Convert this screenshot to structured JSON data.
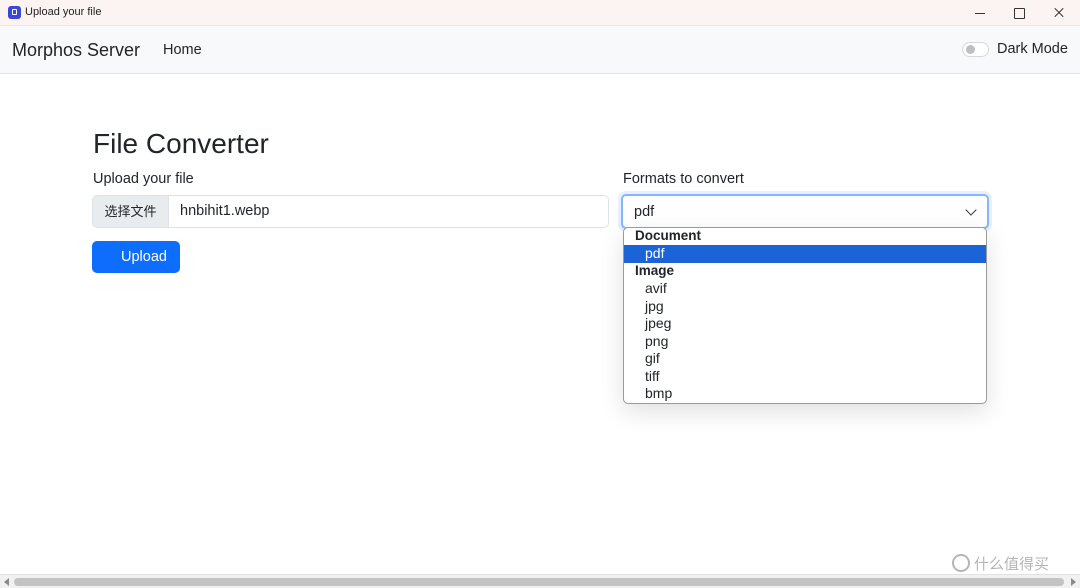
{
  "window": {
    "title": "Upload your file"
  },
  "navbar": {
    "brand": "Morphos Server",
    "home_link": "Home",
    "dark_mode_label": "Dark Mode",
    "dark_mode_on": false
  },
  "main": {
    "title": "File Converter",
    "upload": {
      "label": "Upload your file",
      "choose_button": "选择文件",
      "file_name": "hnbihit1.webp",
      "submit_label": "Upload"
    },
    "formats": {
      "label": "Formats to convert",
      "selected_value": "pdf",
      "dropdown_open": true,
      "groups": [
        {
          "label": "Document",
          "options": [
            "pdf"
          ]
        },
        {
          "label": "Image",
          "options": [
            "avif",
            "jpg",
            "jpeg",
            "png",
            "gif",
            "tiff",
            "bmp"
          ]
        }
      ]
    }
  },
  "watermark": {
    "text": "什么值得买"
  },
  "colors": {
    "primary": "#0d6efd",
    "option_highlight": "#1a64d8",
    "navbar_bg": "#f8f9fa",
    "titlebar_bg": "#fbf4f2"
  }
}
